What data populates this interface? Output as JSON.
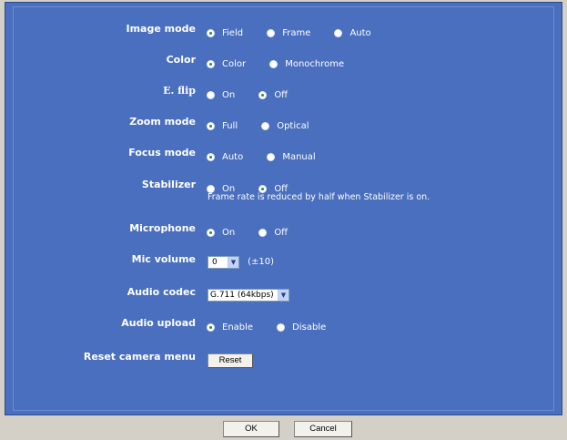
{
  "settings": {
    "image_mode": {
      "label": "Image mode",
      "options": [
        "Field",
        "Frame",
        "Auto"
      ],
      "selected": 0
    },
    "color": {
      "label": "Color",
      "options": [
        "Color",
        "Monochrome"
      ],
      "selected": 0
    },
    "eflip": {
      "label": "E. flip",
      "options": [
        "On",
        "Off"
      ],
      "selected": 1
    },
    "zoom_mode": {
      "label": "Zoom mode",
      "options": [
        "Full",
        "Optical"
      ],
      "selected": 0
    },
    "focus_mode": {
      "label": "Focus mode",
      "options": [
        "Auto",
        "Manual"
      ],
      "selected": 0
    },
    "stabilizer": {
      "label": "Stabilizer",
      "options": [
        "On",
        "Off"
      ],
      "selected": 1,
      "note": "Frame rate is reduced by half when Stabilizer is on."
    },
    "microphone": {
      "label": "Microphone",
      "options": [
        "On",
        "Off"
      ],
      "selected": 0
    },
    "mic_volume": {
      "label": "Mic volume",
      "value": "0",
      "suffix": "(±10)"
    },
    "audio_codec": {
      "label": "Audio codec",
      "value": "G.711 (64kbps)"
    },
    "audio_upload": {
      "label": "Audio upload",
      "options": [
        "Enable",
        "Disable"
      ],
      "selected": 0
    },
    "reset": {
      "label": "Reset camera menu",
      "button": "Reset"
    }
  },
  "footer": {
    "ok": "OK",
    "cancel": "Cancel"
  },
  "icons": {
    "dropdown": "chevron-down-icon"
  }
}
